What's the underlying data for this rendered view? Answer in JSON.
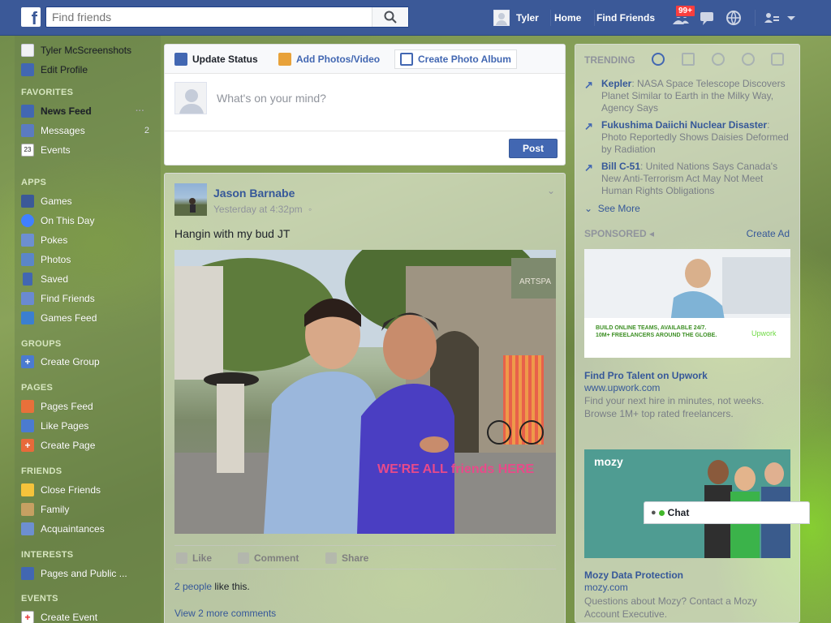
{
  "topbar": {
    "search_placeholder": "Find friends",
    "user_name": "Tyler",
    "home_label": "Home",
    "find_friends_label": "Find Friends",
    "friend_requests_badge": "99+"
  },
  "sidebar": {
    "profile_name": "Tyler McScreenshots",
    "edit_profile": "Edit Profile",
    "sections": {
      "favorites": "FAVORITES",
      "apps": "APPS",
      "groups": "GROUPS",
      "pages": "PAGES",
      "friends": "FRIENDS",
      "interests": "INTERESTS",
      "events": "EVENTS"
    },
    "favorites": [
      {
        "label": "News Feed",
        "count": ""
      },
      {
        "label": "Messages",
        "count": "2"
      },
      {
        "label": "Events",
        "count": ""
      }
    ],
    "events_icon_date": "23",
    "apps": [
      {
        "label": "Games"
      },
      {
        "label": "On This Day"
      },
      {
        "label": "Pokes"
      },
      {
        "label": "Photos"
      },
      {
        "label": "Saved"
      },
      {
        "label": "Find Friends"
      },
      {
        "label": "Games Feed"
      }
    ],
    "groups": [
      {
        "label": "Create Group"
      }
    ],
    "pages": [
      {
        "label": "Pages Feed"
      },
      {
        "label": "Like Pages"
      },
      {
        "label": "Create Page"
      }
    ],
    "friends": [
      {
        "label": "Close Friends"
      },
      {
        "label": "Family"
      },
      {
        "label": "Acquaintances"
      }
    ],
    "interests": [
      {
        "label": "Pages and Public ..."
      }
    ],
    "events": [
      {
        "label": "Create Event"
      }
    ]
  },
  "composer": {
    "tab_update_status": "Update Status",
    "tab_add_photos": "Add Photos/Video",
    "tab_create_album": "Create Photo Album",
    "placeholder": "What's on your mind?",
    "post_button": "Post"
  },
  "story": {
    "author": "Jason Barnabe",
    "timestamp": "Yesterday at 4:32pm",
    "text": "Hangin with my bud JT",
    "actions": {
      "like": "Like",
      "comment": "Comment",
      "share": "Share"
    },
    "likes_link": "2 people",
    "likes_suffix": " like this.",
    "more_comments": "View 2 more comments",
    "photo_shirt_text": "WE'RE ALL friends HERE",
    "photo_sign_text": "ARTSPA"
  },
  "trending": {
    "header": "TRENDING",
    "items": [
      {
        "topic": "Kepler",
        "desc": ": NASA Space Telescope Discovers Planet Similar to Earth in the Milky Way, Agency Says"
      },
      {
        "topic": "Fukushima Daiichi Nuclear Disaster",
        "desc": ": Photo Reportedly Shows Daisies Deformed by Radiation"
      },
      {
        "topic": "Bill C-51",
        "desc": ": United Nations Says Canada's New Anti-Terrorism Act May Not Meet Human Rights Obligations"
      }
    ],
    "see_more": "See More"
  },
  "sponsored": {
    "header": "SPONSORED",
    "create_ad": "Create Ad",
    "ads": [
      {
        "banner_line1": "BUILD ONLINE TEAMS, AVAILABLE 24/7.",
        "banner_line2": "10M+ FREELANCERS AROUND THE GLOBE.",
        "brand": "Upwork",
        "title": "Find Pro Talent on Upwork",
        "url": "www.upwork.com",
        "desc": "Find your next hire in minutes, not weeks. Browse 1M+ top rated freelancers."
      },
      {
        "brand": "mozy",
        "title": "Mozy Data Protection",
        "url": "mozy.com",
        "desc": "Questions about Mozy? Contact a Mozy Account Executive."
      }
    ]
  },
  "chat": {
    "label": "Chat"
  },
  "colors": {
    "brand": "#3b5998",
    "link": "#365899",
    "post_button": "#4267b2",
    "badge": "#fa3e3e",
    "online": "#42b72a"
  }
}
